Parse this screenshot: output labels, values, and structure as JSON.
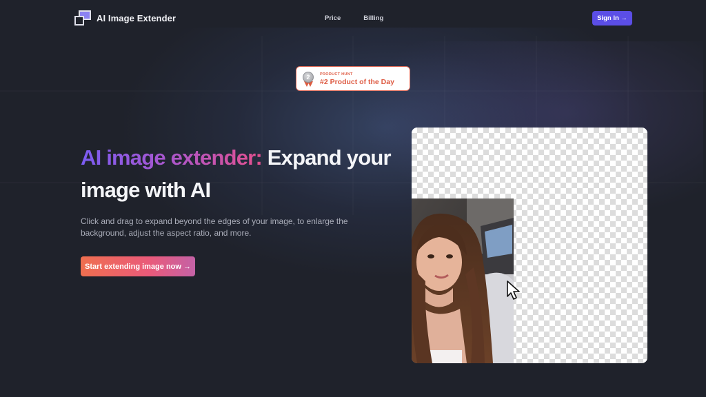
{
  "brand": {
    "name": "AI Image Extender"
  },
  "nav": {
    "links": [
      "Price",
      "Billing"
    ],
    "signin_label": "Sign In →"
  },
  "badge": {
    "top": "PRODUCT HUNT",
    "main": "#2 Product of the Day",
    "medal_number": "2"
  },
  "hero": {
    "title_highlight": "AI image extender:",
    "title_rest": " Expand your image with AI",
    "description": "Click and drag to expand beyond the edges of your image, to enlarge the background, adjust the aspect ratio, and more.",
    "cta_label": "Start extending image now →"
  },
  "colors": {
    "background": "#1f222b",
    "accent": "#5b4ee6",
    "badge_red": "#de5b43",
    "cta_start": "#ef6f4f",
    "cta_end": "#c462a6"
  },
  "icons": {
    "logo": "overlapping-squares-logo",
    "medal": "silver-medal-icon",
    "cursor": "mouse-pointer-icon"
  }
}
